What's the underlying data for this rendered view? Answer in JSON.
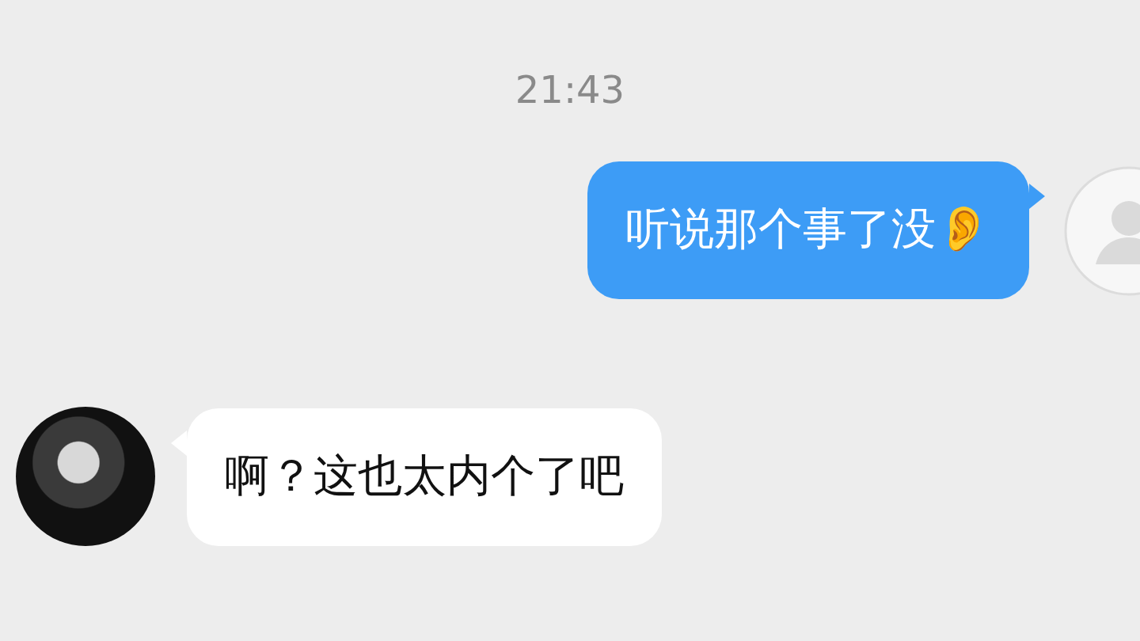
{
  "timestamp": "21:43",
  "messages": [
    {
      "kind": "sent",
      "text": "听说那个事了没👂"
    },
    {
      "kind": "received",
      "text": "啊？这也太内个了吧"
    }
  ]
}
